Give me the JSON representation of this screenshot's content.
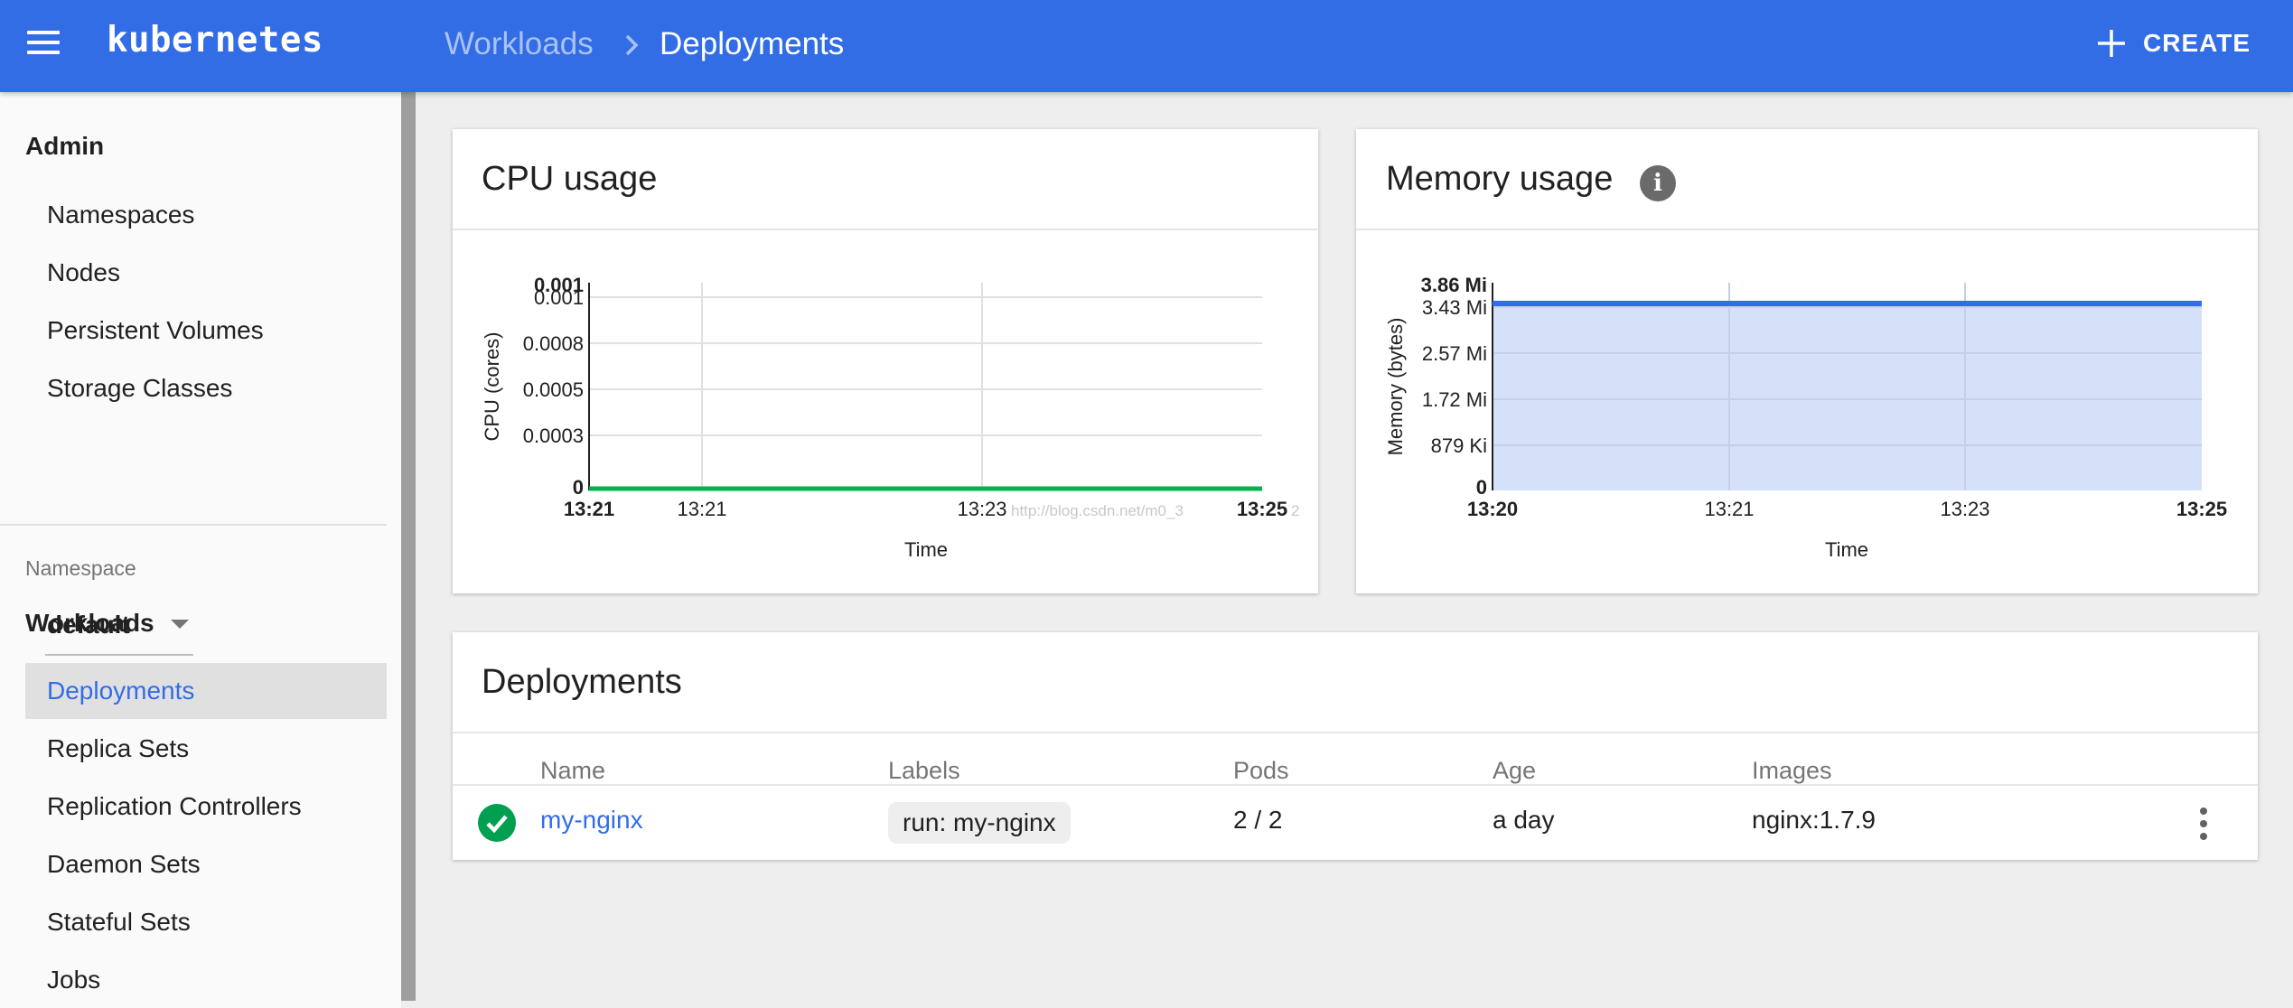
{
  "header": {
    "brand": "kubernetes",
    "breadcrumb_parent": "Workloads",
    "breadcrumb_current": "Deployments",
    "create_label": "CREATE",
    "color": "#326de6"
  },
  "sidebar": {
    "admin_title": "Admin",
    "admin_items": [
      "Namespaces",
      "Nodes",
      "Persistent Volumes",
      "Storage Classes"
    ],
    "namespace_label": "Namespace",
    "namespace_value": "default",
    "workloads_title": "Workloads",
    "workload_items": [
      "Deployments",
      "Replica Sets",
      "Replication Controllers",
      "Daemon Sets",
      "Stateful Sets",
      "Jobs"
    ],
    "active_item": "Deployments"
  },
  "cpu_card": {
    "title": "CPU usage",
    "watermark": "http://blog.csdn.net/m0_3",
    "watermark_tail": "2"
  },
  "memory_card": {
    "title": "Memory usage",
    "info_glyph": "i"
  },
  "chart_data": [
    {
      "type": "line",
      "title": "CPU usage",
      "xlabel": "Time",
      "ylabel": "CPU (cores)",
      "x_ticks": [
        "13:21",
        "13:21",
        "13:23",
        "13:25"
      ],
      "y_ticks": [
        "0",
        "0.0003",
        "0.0005",
        "0.0008",
        "0.001",
        "0.001"
      ],
      "ylim": [
        0,
        0.0012
      ],
      "series": [
        {
          "values": [
            [
              0,
              0
            ],
            [
              1,
              0
            ]
          ],
          "color": "#00b34a"
        }
      ],
      "grid": true
    },
    {
      "type": "area",
      "title": "Memory usage",
      "xlabel": "Time",
      "ylabel": "Memory (bytes)",
      "x_ticks": [
        "13:20",
        "13:21",
        "13:23",
        "13:25"
      ],
      "y_ticks": [
        "0",
        "879 Ki",
        "1.72 Mi",
        "2.57 Mi",
        "3.43 Mi",
        "3.86 Mi"
      ],
      "ylim": [
        0,
        3.86
      ],
      "series": [
        {
          "values": [
            [
              0,
              3.38
            ],
            [
              1,
              3.38
            ]
          ],
          "color": "#326de6",
          "fill": "#d5e1f9"
        }
      ],
      "grid": true
    }
  ],
  "deployments": {
    "title": "Deployments",
    "columns": [
      "Name",
      "Labels",
      "Pods",
      "Age",
      "Images"
    ],
    "rows": [
      {
        "status": "running",
        "name": "my-nginx",
        "labels": "run: my-nginx",
        "pods": "2 / 2",
        "age": "a day",
        "images": "nginx:1.7.9"
      }
    ]
  }
}
